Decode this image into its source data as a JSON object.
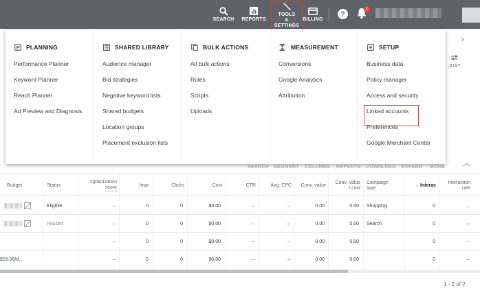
{
  "topbar": {
    "search_label": "SEARCH",
    "reports_label": "REPORTS",
    "tools_label_1": "TOOLS",
    "tools_label_2": "&",
    "tools_label_3": "SETTINGS",
    "billing_label": "BILLING",
    "help_glyph": "?",
    "notification_count": "!"
  },
  "background": {
    "adjust_label_1": "",
    "adjust_label_2": "JUST"
  },
  "menu": {
    "planning": {
      "title": "PLANNING",
      "items": [
        "Performance Planner",
        "Keyword Planner",
        "Reach Planner",
        "Ad Preview and Diagnosis"
      ]
    },
    "shared_library": {
      "title": "SHARED LIBRARY",
      "items": [
        "Audience manager",
        "Bid strategies",
        "Negative keyword lists",
        "Shared budgets",
        "Location groups",
        "Placement exclusion lists"
      ]
    },
    "bulk_actions": {
      "title": "BULK ACTIONS",
      "items": [
        "All bulk actions",
        "Rules",
        "Scripts",
        "Uploads"
      ]
    },
    "measurement": {
      "title": "MEASUREMENT",
      "items": [
        "Conversions",
        "Google Analytics",
        "Attribution"
      ]
    },
    "setup": {
      "title": "SETUP",
      "items": [
        "Business data",
        "Policy manager",
        "Access and security",
        "Linked accounts",
        "Preferences",
        "Google Merchant Center"
      ]
    }
  },
  "table_toolbar": [
    "SEARCH",
    "SEGMENT",
    "COLUMNS",
    "REPORTS",
    "DOWNLOAD",
    "EXPAND",
    "MORE"
  ],
  "table": {
    "headers": {
      "budget": "Budget",
      "status": "Status",
      "opt_1": "Optimization",
      "opt_2": "score",
      "impr": "Impr.",
      "clicks": "Clicks",
      "cost": "Cost",
      "ctr": "CTR",
      "avg_cpc": "Avg. CPC",
      "conv_value": "Conv. value",
      "conv_cost_1": "Conv. value",
      "conv_cost_2": "/ cost",
      "camp_type_1": "Campaign",
      "camp_type_2": "type",
      "interactions": "Interac",
      "int_rate_1": "Interaction",
      "int_rate_2": "rate"
    },
    "rows": [
      {
        "budget": "",
        "status": "Eligible",
        "opt": "–",
        "impr": "0",
        "clicks": "0",
        "cost": "$0.00",
        "ctr": "–",
        "avg_cpc": "–",
        "conv_value": "0.00",
        "conv_cost": "0.00",
        "camp_type": "Shopping",
        "interactions": "0",
        "int_rate": "–"
      },
      {
        "budget": "",
        "status": "Paused",
        "opt": "–",
        "impr": "0",
        "clicks": "0",
        "cost": "$0.00",
        "ctr": "–",
        "avg_cpc": "–",
        "conv_value": "0.00",
        "conv_cost": "0.00",
        "camp_type": "Search",
        "interactions": "0",
        "int_rate": "–"
      },
      {
        "budget": "",
        "status": "",
        "opt": "–",
        "impr": "0",
        "clicks": "0",
        "cost": "$0.00",
        "ctr": "–",
        "avg_cpc": "–",
        "conv_value": "0.00",
        "conv_cost": "0.00",
        "camp_type": "",
        "interactions": "0",
        "int_rate": "–"
      },
      {
        "budget": "$15.00/d...",
        "status": "",
        "opt": "–",
        "impr": "0",
        "clicks": "0",
        "cost": "$0.00",
        "ctr": "–",
        "avg_cpc": "–",
        "conv_value": "0.00",
        "conv_cost": "0.00",
        "camp_type": "",
        "interactions": "0",
        "int_rate": "–"
      }
    ],
    "pager": "1 - 2 of 2"
  },
  "colors": {
    "topbar": "#5f6368",
    "highlight": "#e53935",
    "badge": "#ea4335"
  }
}
